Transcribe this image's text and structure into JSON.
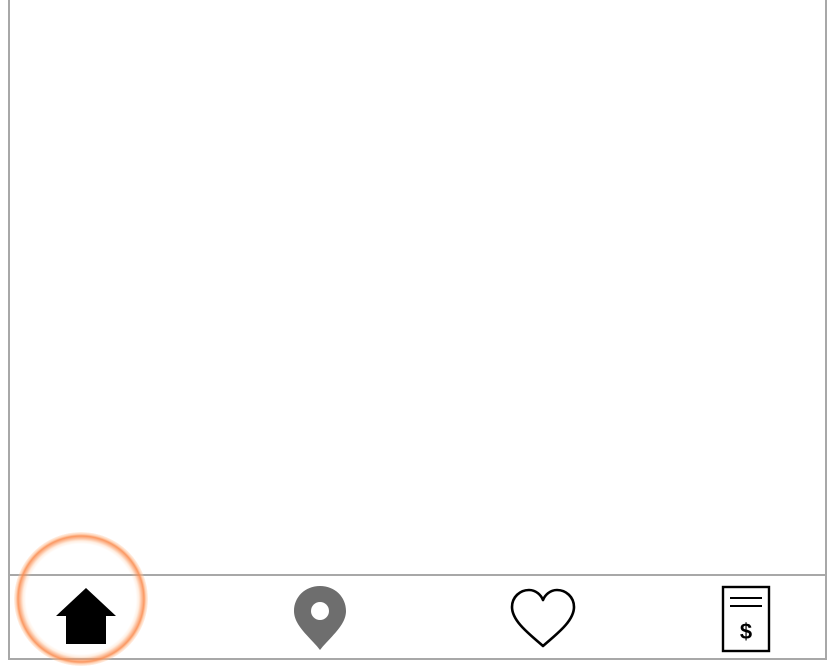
{
  "tab_bar": {
    "active_tab": "home",
    "tabs": [
      {
        "id": "home",
        "icon": "home-icon",
        "color": "#000000"
      },
      {
        "id": "location",
        "icon": "map-pin-icon",
        "color": "#6e6e6e"
      },
      {
        "id": "favorites",
        "icon": "heart-outline-icon",
        "color": "#000000"
      },
      {
        "id": "bills",
        "icon": "receipt-dollar-icon",
        "color": "#000000",
        "glyph": "$"
      }
    ]
  },
  "highlight": {
    "target": "home",
    "color": "#f58a4b"
  }
}
